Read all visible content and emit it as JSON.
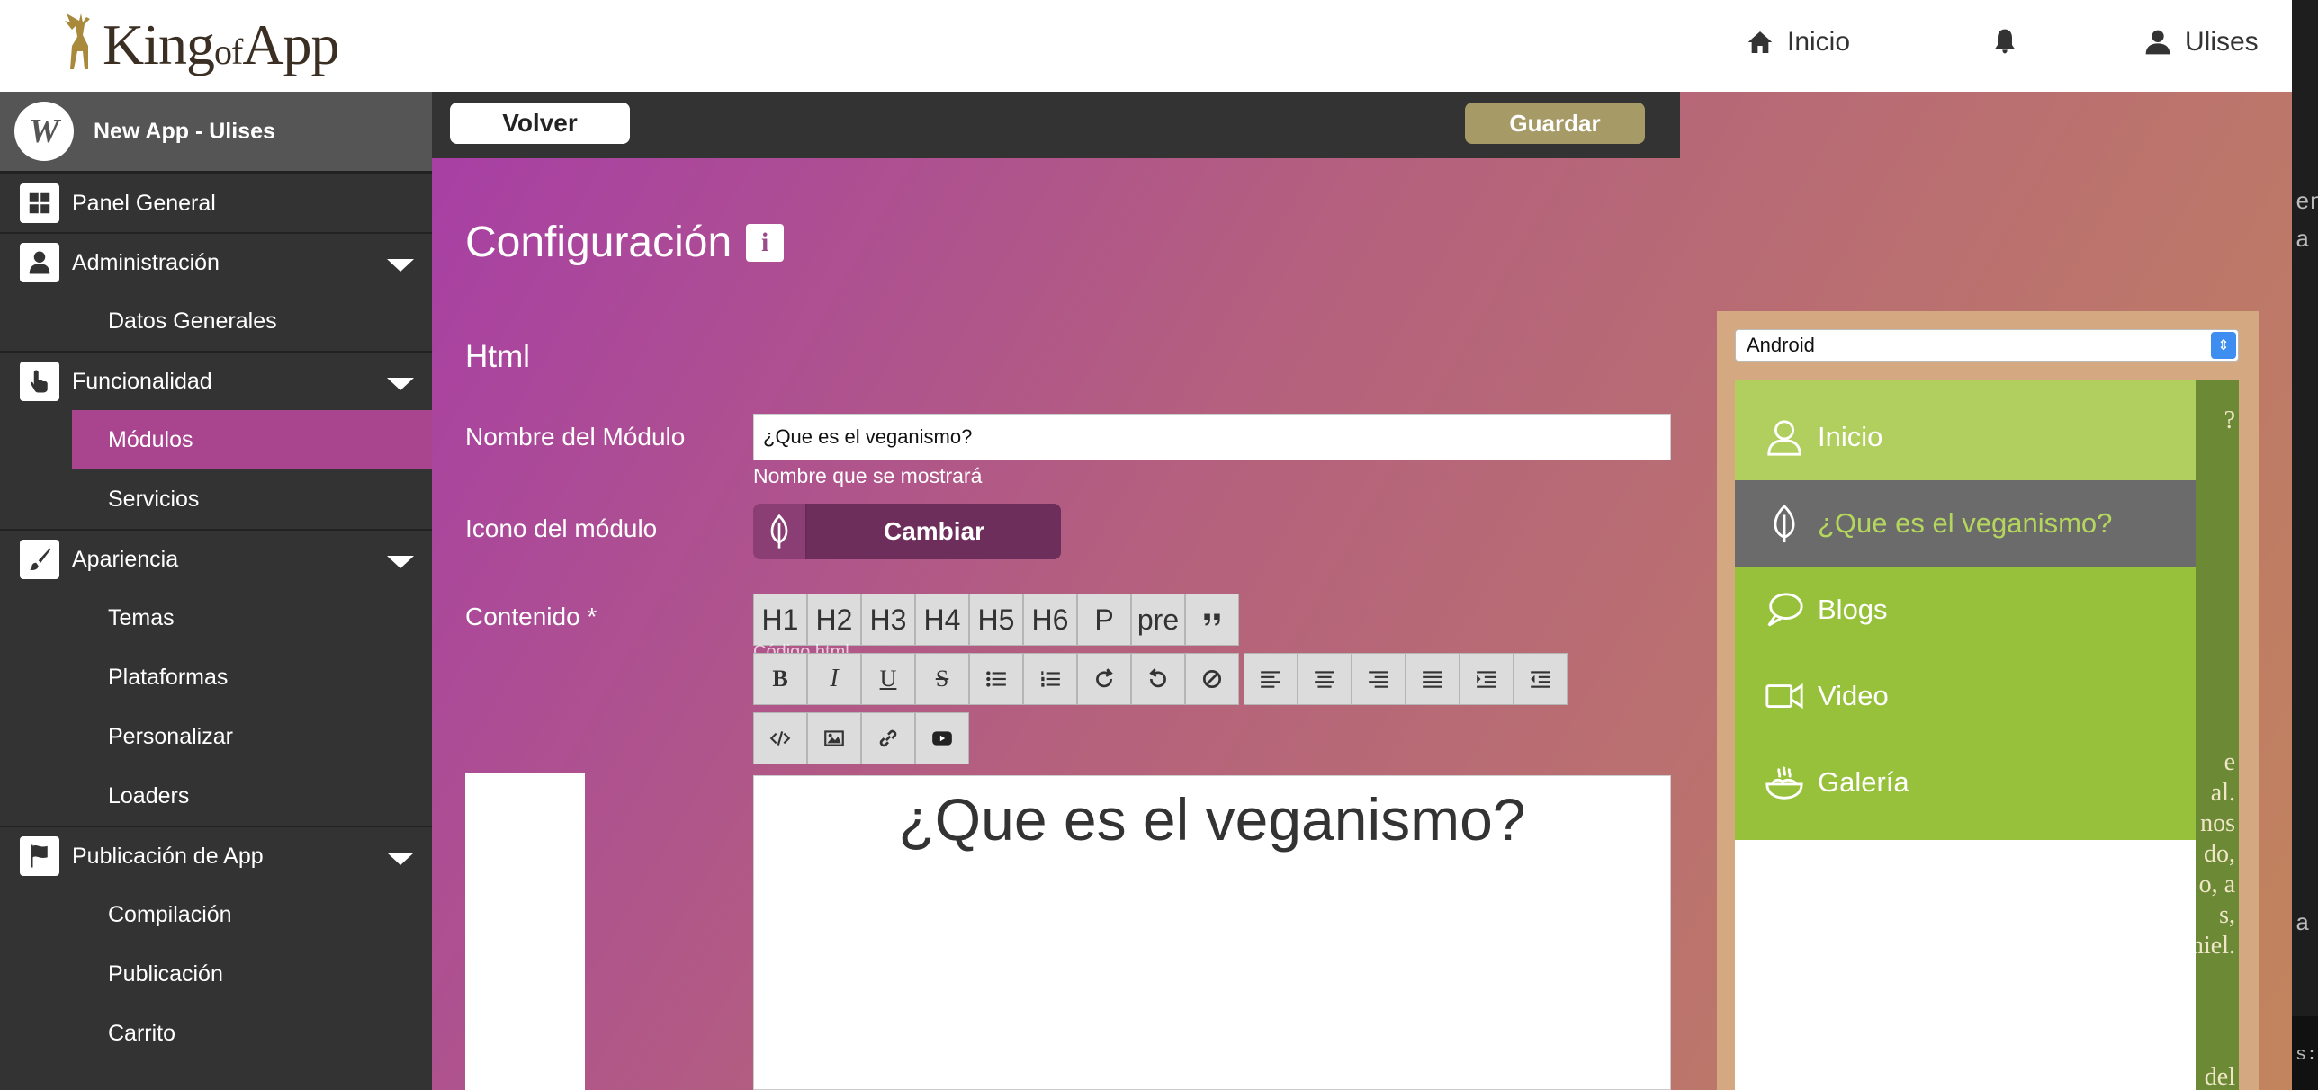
{
  "header": {
    "logo_text_main": "King",
    "logo_text_of": "of",
    "logo_text_app": "App",
    "nav": {
      "home_label": "Inicio",
      "user_label": "Ulises"
    }
  },
  "sidebar": {
    "app_name": "New App - Ulises",
    "avatar_text": "W",
    "panel_general": "Panel General",
    "administracion": "Administración",
    "datos_generales": "Datos Generales",
    "funcionalidad": "Funcionalidad",
    "modulos": "Módulos",
    "servicios": "Servicios",
    "apariencia": "Apariencia",
    "temas": "Temas",
    "plataformas": "Plataformas",
    "personalizar": "Personalizar",
    "loaders": "Loaders",
    "publicacion_app": "Publicación de App",
    "compilacion": "Compilación",
    "publicacion": "Publicación",
    "carrito": "Carrito"
  },
  "actions": {
    "back_label": "Volver",
    "save_label": "Guardar"
  },
  "page": {
    "title": "Configuración",
    "info_glyph": "i",
    "section_title": "Html",
    "module_name_label": "Nombre del Módulo",
    "module_name_value": "¿Que es el veganismo?",
    "module_name_help": "Nombre que se mostrará",
    "module_icon_label": "Icono del módulo",
    "change_label": "Cambiar",
    "content_label": "Contenido *"
  },
  "editor": {
    "headings": [
      "H1",
      "H2",
      "H3",
      "H4",
      "H5",
      "H6",
      "P",
      "pre"
    ],
    "code_label": "Código html",
    "bold": "B",
    "italic": "I",
    "underline": "U",
    "strike": "S",
    "content_heading": "¿Que es el veganismo?"
  },
  "preview": {
    "platform_selected": "Android",
    "menu": [
      {
        "label": "Inicio",
        "icon": "user-outline-icon"
      },
      {
        "label": "¿Que es el veganismo?",
        "icon": "leaf-icon"
      },
      {
        "label": "Blogs",
        "icon": "speech-bubble-icon"
      },
      {
        "label": "Video",
        "icon": "video-camera-icon"
      },
      {
        "label": "Galería",
        "icon": "food-bowl-icon"
      }
    ],
    "bg_text": [
      "?",
      "e",
      "al.",
      "nos",
      "do,",
      "o, a",
      "s,",
      "miel.",
      "del"
    ]
  },
  "edge": {
    "text_top": "en",
    "text_mid": "a",
    "text_low": "a",
    "text_bottom": "s:"
  },
  "colors": {
    "accent_magenta": "#a9458f",
    "sidebar_bg": "#333333",
    "save_button": "#a69a66",
    "drawer_green": "#97c13b",
    "drawer_active": "#6b6b6b"
  }
}
